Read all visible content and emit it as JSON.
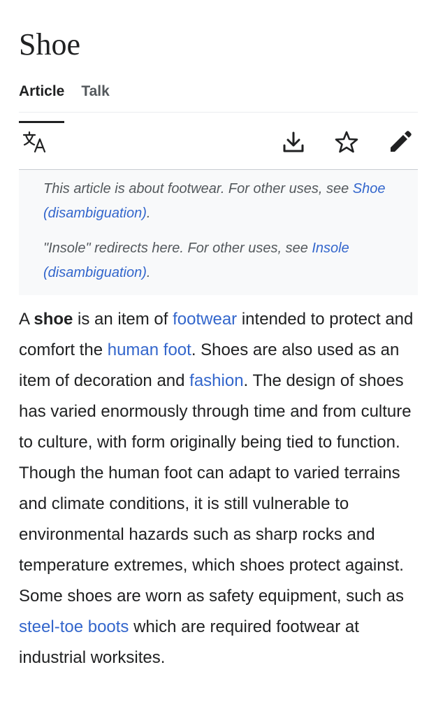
{
  "article": {
    "title": "Shoe"
  },
  "tabs": [
    {
      "label": "Article",
      "active": true
    },
    {
      "label": "Talk",
      "active": false
    }
  ],
  "toolbar": {
    "icons": [
      "language-icon",
      "download-icon",
      "star-icon",
      "edit-pencil-icon"
    ]
  },
  "hatnotes": [
    {
      "prefix": "This article is about footwear. For other uses, see ",
      "link": "Shoe (disambiguation)",
      "suffix": "."
    },
    {
      "prefix": "\"Insole\" redirects here. For other uses, see ",
      "link": "Insole (disambiguation)",
      "suffix": "."
    }
  ],
  "intro": {
    "t1": "A ",
    "bold": "shoe",
    "t2": " is an item of ",
    "link_footwear": "footwear",
    "t3": " intended to protect and comfort the ",
    "link_human_foot": "human foot",
    "t4": ". Shoes are also used as an item of decoration and ",
    "link_fashion": "fashion",
    "t5": ". The design of shoes has varied enormously through time and from culture to culture, with form originally being tied to function. Though the human foot can adapt to varied terrains and climate conditions, it is still vulnerable to environmental hazards such as sharp rocks and temperature extremes, which shoes protect against. Some shoes are worn as safety equipment, such as ",
    "link_steel_toe": "steel-toe boots",
    "t6": " which are required footwear at industrial worksites."
  },
  "colors": {
    "link": "#3366cc",
    "text": "#202122",
    "hatnote_bg": "#f8f9fa"
  }
}
